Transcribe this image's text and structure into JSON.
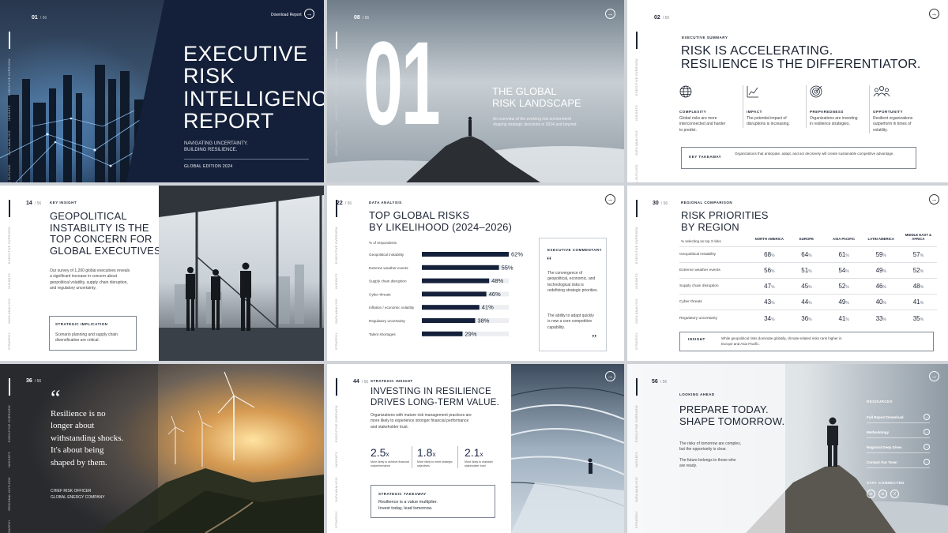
{
  "vnav": [
    "EXECUTIVE OVERVIEW",
    "INSIGHTS",
    "DATA ANALYSIS",
    "REGIONAL OUTLOOK",
    "STRATEGY"
  ],
  "s1": {
    "page": "01",
    "total": "/ 56",
    "download": "Download Report",
    "title": [
      "EXECUTIVE",
      "RISK",
      "INTELLIGENCE",
      "REPORT"
    ],
    "subtitle": [
      "NAVIGATING UNCERTAINTY.",
      "BUILDING RESILIENCE."
    ],
    "edition": "GLOBAL EDITION 2024"
  },
  "s2": {
    "page": "08",
    "total": "/ 56",
    "big": "01",
    "title": [
      "THE GLOBAL",
      "RISK LANDSCAPE"
    ],
    "desc": "An overview of the evolving risk environment shaping strategic decisions in 2024 and beyond."
  },
  "s3": {
    "page": "02",
    "total": "/ 56",
    "kicker": "EXECUTIVE SUMMARY",
    "title": [
      "RISK IS ACCELERATING.",
      "RESILIENCE IS THE DIFFERENTIATOR."
    ],
    "pillars": [
      {
        "icon": "globe-icon",
        "label": "COMPLEXITY",
        "text": "Global risks are more interconnected and harder to predict."
      },
      {
        "icon": "line-chart-icon",
        "label": "IMPACT",
        "text": "The potential impact of disruptions is increasing."
      },
      {
        "icon": "target-icon",
        "label": "PREPAREDNESS",
        "text": "Organizations are investing in resilience strategies."
      },
      {
        "icon": "people-icon",
        "label": "OPPORTUNITY",
        "text": "Resilient organizations outperform in times of volatility."
      }
    ],
    "takeaway_label": "KEY TAKEAWAY",
    "takeaway_text": "Organizations that anticipate, adapt, and act decisively will create sustainable competitive advantage."
  },
  "s4": {
    "page": "14",
    "total": "/ 56",
    "kicker": "KEY INSIGHT",
    "title": [
      "GEOPOLITICAL",
      "INSTABILITY IS THE",
      "TOP CONCERN FOR",
      "GLOBAL EXECUTIVES."
    ],
    "body": "Our survey of 1,200 global executives reveals a significant increase in concern about geopolitical volatility, supply chain disruption, and regulatory uncertainty.",
    "box_label": "STRATEGIC IMPLICATION",
    "box_text": "Scenario planning and supply chain diversification are critical."
  },
  "s5": {
    "page": "22",
    "total": "/ 56",
    "kicker": "DATA ANALYSIS",
    "title": [
      "TOP GLOBAL RISKS",
      "BY LIKELIHOOD (2024–2026)"
    ],
    "unit": "% of respondents",
    "comment_label": "EXECUTIVE COMMENTARY",
    "comment_p1": "The convergence of geopolitical, economic, and technological risks is redefining strategic priorities.",
    "comment_p2": "The ability to adapt quickly is now a core competitive capability."
  },
  "chart_data": {
    "type": "bar",
    "orientation": "horizontal",
    "title": "TOP GLOBAL RISKS BY LIKELIHOOD (2024–2026)",
    "ylabel": "% of respondents",
    "categories": [
      "Geopolitical instability",
      "Extreme weather events",
      "Supply chain disruption",
      "Cyber threats",
      "Inflation / economic volatility",
      "Regulatory uncertainty",
      "Talent shortages"
    ],
    "values": [
      62,
      55,
      48,
      46,
      41,
      38,
      29
    ],
    "xlim": [
      0,
      62
    ],
    "color": "#15213a",
    "track_color": "#eceef1"
  },
  "s6": {
    "page": "30",
    "total": "/ 56",
    "kicker": "REGIONAL COMPARISON",
    "title": [
      "RISK PRIORITIES",
      "BY REGION"
    ],
    "unit": "% selecting as top 3 risks",
    "columns": [
      "NORTH AMERICA",
      "EUROPE",
      "ASIA PACIFIC",
      "LATIN AMERICA",
      "MIDDLE EAST & AFRICA"
    ],
    "rows": [
      {
        "name": "Geopolitical instability",
        "vals": [
          "68",
          "64",
          "61",
          "59",
          "57"
        ]
      },
      {
        "name": "Extreme weather events",
        "vals": [
          "56",
          "51",
          "54",
          "49",
          "52"
        ]
      },
      {
        "name": "Supply chain disruption",
        "vals": [
          "47",
          "45",
          "52",
          "46",
          "48"
        ]
      },
      {
        "name": "Cyber threats",
        "vals": [
          "43",
          "44",
          "49",
          "40",
          "41"
        ]
      },
      {
        "name": "Regulatory uncertainty",
        "vals": [
          "34",
          "36",
          "41",
          "33",
          "35"
        ]
      }
    ],
    "pct": "%",
    "insight_label": "INSIGHT",
    "insight_text": "While geopolitical risks dominate globally, climate-related risks rank higher in Europe and Asia Pacific."
  },
  "s7": {
    "page": "36",
    "total": "/ 56",
    "quote_mark": "“",
    "quote": [
      "Resilience is no",
      "longer about",
      "withstanding shocks.",
      "It's about being",
      "shaped by them."
    ],
    "role": "CHIEF RISK OFFICER",
    "company": "GLOBAL ENERGY COMPANY"
  },
  "s8": {
    "page": "44",
    "total": "/ 56",
    "kicker": "STRATEGIC INSIGHT",
    "title": [
      "INVESTING IN RESILIENCE",
      "DRIVES LONG-TERM VALUE."
    ],
    "body": "Organizations with mature risk management practices are more likely to experience stronger financial performance and stakeholder trust.",
    "stats": [
      {
        "value": "2.5",
        "unit": "x",
        "text": "More likely to achieve financial outperformance"
      },
      {
        "value": "1.8",
        "unit": "x",
        "text": "More likely to meet strategic objectives"
      },
      {
        "value": "2.1",
        "unit": "x",
        "text": "More likely to maintain stakeholder trust"
      }
    ],
    "box_label": "STRATEGIC TAKEAWAY",
    "box_text": [
      "Resilience is a value multiplier.",
      "Invest today, lead tomorrow."
    ]
  },
  "s9": {
    "page": "56",
    "total": "/ 56",
    "kicker": "LOOKING AHEAD",
    "title": [
      "PREPARE TODAY.",
      "SHAPE TOMORROW."
    ],
    "p1": "The risks of tomorrow are complex, but the opportunity is clear.",
    "p2": "The future belongs to those who are ready.",
    "resources_label": "RESOURCES",
    "resources": [
      "Full Report Download",
      "Methodology",
      "Regional Deep Dives",
      "Contact Our Team"
    ],
    "social_label": "STAY CONNECTED",
    "social": [
      "in",
      "in",
      "X"
    ]
  }
}
